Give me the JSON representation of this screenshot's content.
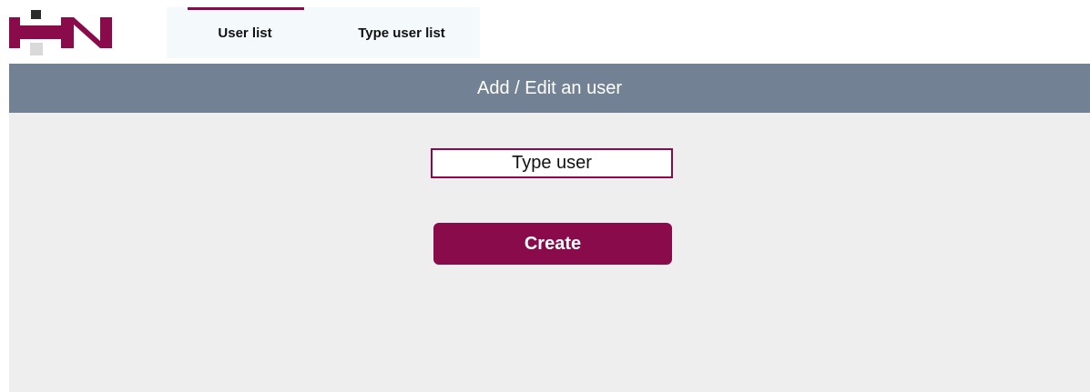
{
  "header": {
    "logo_name": "hn-logo",
    "tabs": [
      {
        "label": "User list",
        "active": true
      },
      {
        "label": "Type user list",
        "active": false
      }
    ],
    "accent_color": "#8a0b4b"
  },
  "panel": {
    "title": "Add / Edit an user",
    "header_color": "#728193",
    "background_color": "#eeeeee",
    "type_user_input": {
      "value": "",
      "placeholder": "Type user"
    },
    "create_button_label": "Create"
  }
}
